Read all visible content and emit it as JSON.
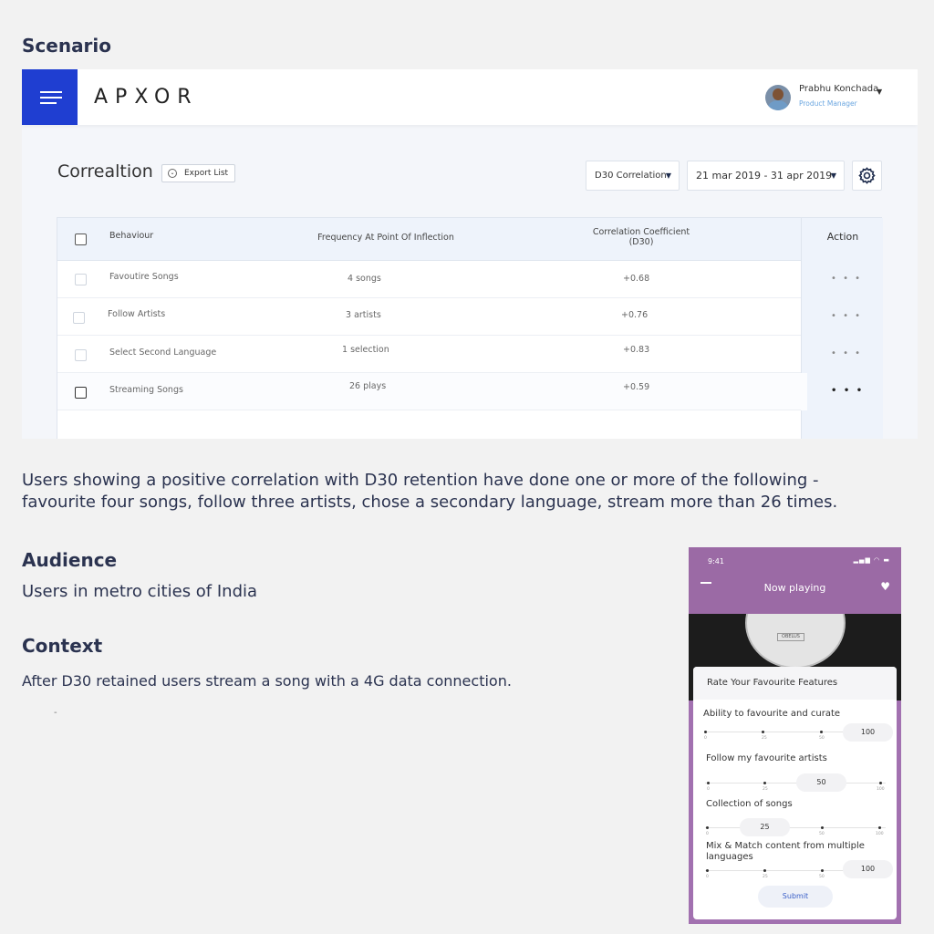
{
  "sections": {
    "scenario": "Scenario",
    "audience": "Audience",
    "context": "Context"
  },
  "dashboard": {
    "logo": "APXOR",
    "user": {
      "name": "Prabhu Konchada",
      "role": "Product Manager"
    },
    "page_title": "Correaltion",
    "export_label": "Export List",
    "metric_select": "D30 Correlation",
    "date_range": "21 mar 2019 - 31 apr 2019",
    "table": {
      "headers": {
        "behaviour": "Behaviour",
        "frequency": "Frequency At Point Of Inflection",
        "coefficient_line1": "Correlation Coefficient",
        "coefficient_line2": "(D30)",
        "action": "Action"
      },
      "rows": [
        {
          "behaviour": "Favoutire Songs",
          "frequency": "4 songs",
          "coefficient": "+0.68"
        },
        {
          "behaviour": "Follow Artists",
          "frequency": "3 artists",
          "coefficient": "+0.76"
        },
        {
          "behaviour": "Select Second Language",
          "frequency": "1 selection",
          "coefficient": "+0.83"
        },
        {
          "behaviour": "Streaming Songs",
          "frequency": "26 plays",
          "coefficient": "+0.59"
        }
      ],
      "row_action_glyph": "• • •"
    }
  },
  "summary_line1": "Users showing a positive correlation with D30 retention have done one or more of the following -",
  "summary_line2": "favourite four songs, follow three artists, chose a secondary language, stream more than 26 times.",
  "audience_text": "Users in metro cities of India",
  "context_text": "After D30 retained users stream a song with a 4G data connection.",
  "stray_mark": "-",
  "phone": {
    "time": "9:41",
    "title": "Now playing",
    "record_label": "OBELUS",
    "card_title": "Rate Your Favourite Features",
    "sliders": [
      {
        "label": "Ability to favourite and curate",
        "value": "100"
      },
      {
        "label": "Follow my favourite artists",
        "value": "50"
      },
      {
        "label": "Collection of songs",
        "value": "25"
      },
      {
        "label_line1": "Mix & Match content from multiple",
        "label_line2": "languages",
        "value": "100"
      }
    ],
    "tick_labels": [
      "0",
      "25",
      "50",
      "100"
    ],
    "submit": "Submit"
  },
  "colors": {
    "brand_blue": "#1f3ed1",
    "phone_purple": "#a271b0",
    "text_navy": "#2b3350"
  }
}
